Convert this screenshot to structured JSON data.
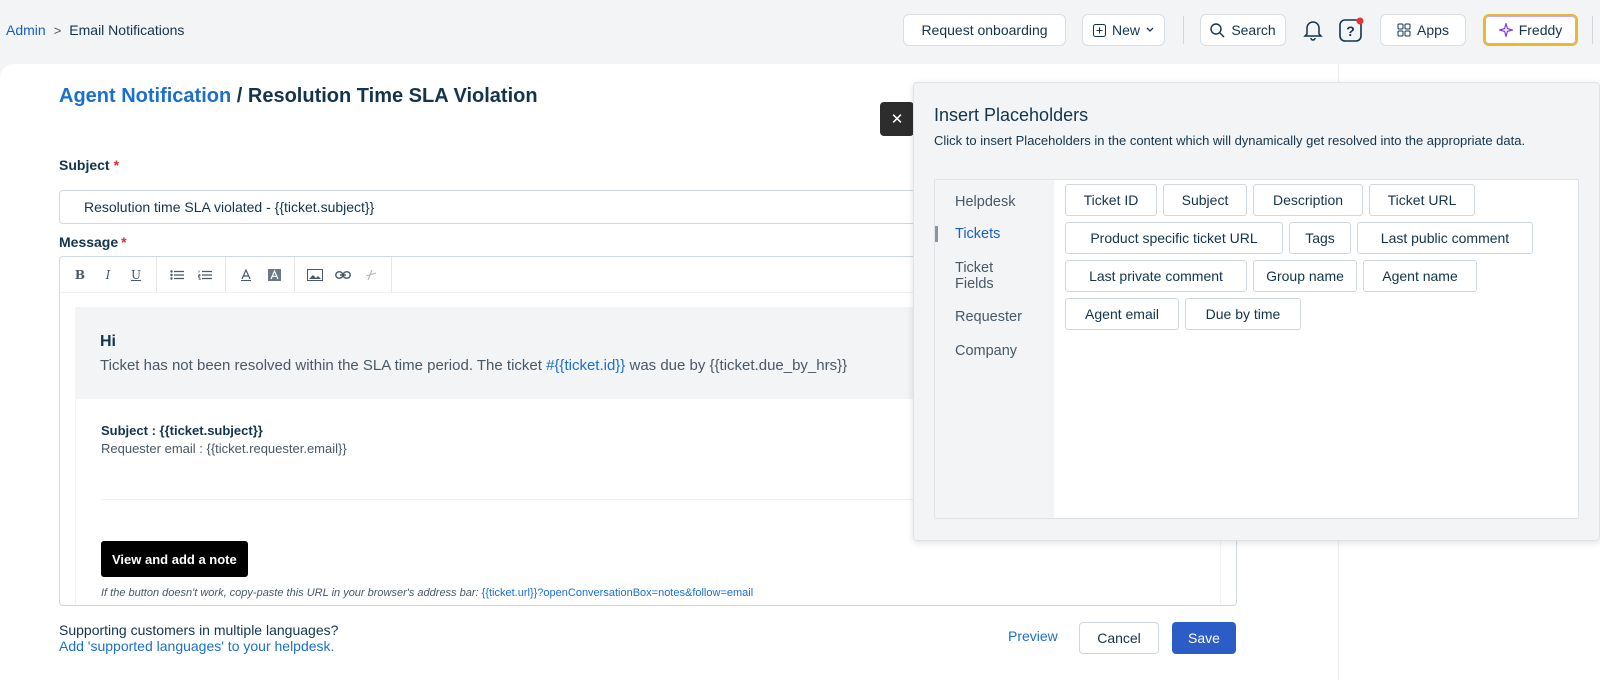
{
  "breadcrumb": {
    "admin": "Admin",
    "separator": ">",
    "current": "Email Notifications"
  },
  "topbar": {
    "request_onboarding": "Request onboarding",
    "new_label": "New",
    "search_label": "Search",
    "apps_label": "Apps",
    "freddy_label": "Freddy",
    "icons": [
      "plus-square-icon",
      "chevron-down-icon",
      "search-icon",
      "bell-icon",
      "help-icon",
      "apps-icon",
      "sparkle-icon"
    ]
  },
  "page": {
    "title_link": "Agent Notification",
    "title_rest": "/ Resolution Time SLA Violation"
  },
  "form": {
    "subject_label": "Subject",
    "subject_value": "Resolution time SLA violated - {{ticket.subject}}",
    "message_label": "Message",
    "required_mark": "*"
  },
  "toolbar": {
    "bold": "B",
    "italic": "I",
    "underline": "U",
    "items": [
      "bold",
      "italic",
      "underline",
      "bulleted-list",
      "numbered-list",
      "font-color",
      "background-color",
      "image",
      "link",
      "clear-format"
    ]
  },
  "email_body": {
    "greeting": "Hi",
    "line_start": "Ticket has not been resolved within the SLA time period. The ticket ",
    "ticket_link": "#{{ticket.id}}",
    "line_end": " was due by {{ticket.due_by_hrs}}",
    "subject_line": "Subject : {{ticket.subject}}",
    "requester_line": "Requester email : {{ticket.requester.email}}",
    "note_button": "View and add a note",
    "fallback_text": "If the button doesn't work, copy-paste this URL in your browser's address bar: ",
    "fallback_url": "{{ticket.url}}?openConversationBox=notes&follow=email"
  },
  "footer": {
    "support_text": "Supporting customers in multiple languages?",
    "support_link": "Add 'supported languages' to your helpdesk.",
    "preview": "Preview",
    "cancel": "Cancel",
    "save": "Save"
  },
  "placeholders": {
    "close_glyph": "✕",
    "title": "Insert Placeholders",
    "description": "Click to insert Placeholders in the content which will dynamically get resolved into the appropriate data.",
    "categories": [
      "Helpdesk",
      "Tickets",
      "Ticket Fields",
      "Requester",
      "Company"
    ],
    "active_category": "Tickets",
    "chips": [
      "Ticket ID",
      "Subject",
      "Description",
      "Ticket URL",
      "Product specific ticket URL",
      "Tags",
      "Last public comment",
      "Last private comment",
      "Group name",
      "Agent name",
      "Agent email",
      "Due by time"
    ]
  },
  "colors": {
    "accent": "#1a6fd1",
    "save": "#2c5cc5",
    "required": "#d72d30",
    "freddy_border": "#e8b92c"
  }
}
